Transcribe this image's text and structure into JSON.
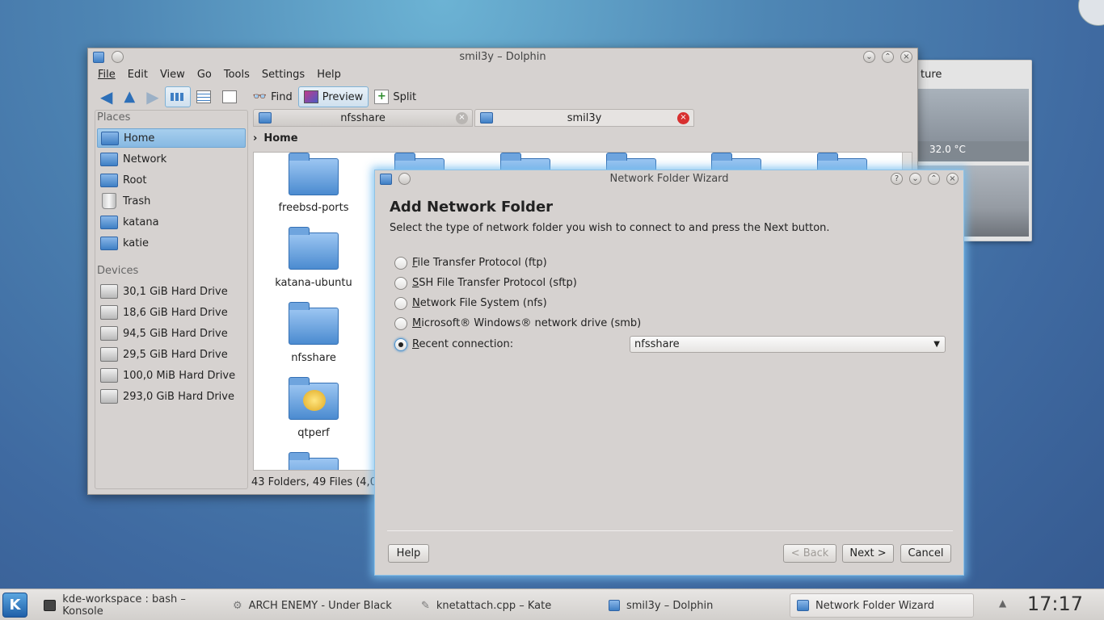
{
  "weather": {
    "title_partial": "ture",
    "temperature": "32.0 °C"
  },
  "dolphin": {
    "title": "smil3y – Dolphin",
    "menu": [
      "File",
      "Edit",
      "View",
      "Go",
      "Tools",
      "Settings",
      "Help"
    ],
    "toolbar": {
      "find": "Find",
      "preview": "Preview",
      "split": "Split"
    },
    "places_header": "Places",
    "places": [
      "Home",
      "Network",
      "Root",
      "Trash",
      "katana",
      "katie"
    ],
    "devices_header": "Devices",
    "devices": [
      "30,1 GiB Hard Drive",
      "18,6 GiB Hard Drive",
      "94,5 GiB Hard Drive",
      "29,5 GiB Hard Drive",
      "100,0 MiB Hard Drive",
      "293,0 GiB Hard Drive"
    ],
    "tabs": [
      "nfsshare",
      "smil3y"
    ],
    "breadcrumb": "Home",
    "folders": [
      "freebsd-ports",
      "katana-ubuntu",
      "nfsshare",
      "qtperf"
    ],
    "status": "43 Folders, 49 Files (4,0"
  },
  "wizard": {
    "title": "Network Folder Wizard",
    "heading": "Add Network Folder",
    "instructions": "Select the type of network folder you wish to connect to and press the Next button.",
    "options": [
      {
        "mnemonic": "F",
        "rest": "ile Transfer Protocol (ftp)"
      },
      {
        "mnemonic": "S",
        "rest": "SH File Transfer Protocol (sftp)"
      },
      {
        "mnemonic": "N",
        "rest": "etwork File System (nfs)"
      },
      {
        "mnemonic": "M",
        "rest": "icrosoft® Windows® network drive (smb)"
      },
      {
        "mnemonic": "R",
        "rest": "ecent connection:"
      }
    ],
    "selected_option": 4,
    "recent_value": "nfsshare",
    "buttons": {
      "help": "Help",
      "back": "< Back",
      "next": "Next >",
      "cancel": "Cancel"
    }
  },
  "taskbar": {
    "tasks": [
      "kde-workspace : bash – Konsole",
      "ARCH ENEMY - Under Black",
      "knetattach.cpp – Kate",
      "smil3y – Dolphin",
      "Network Folder Wizard"
    ],
    "clock": "17:17"
  }
}
